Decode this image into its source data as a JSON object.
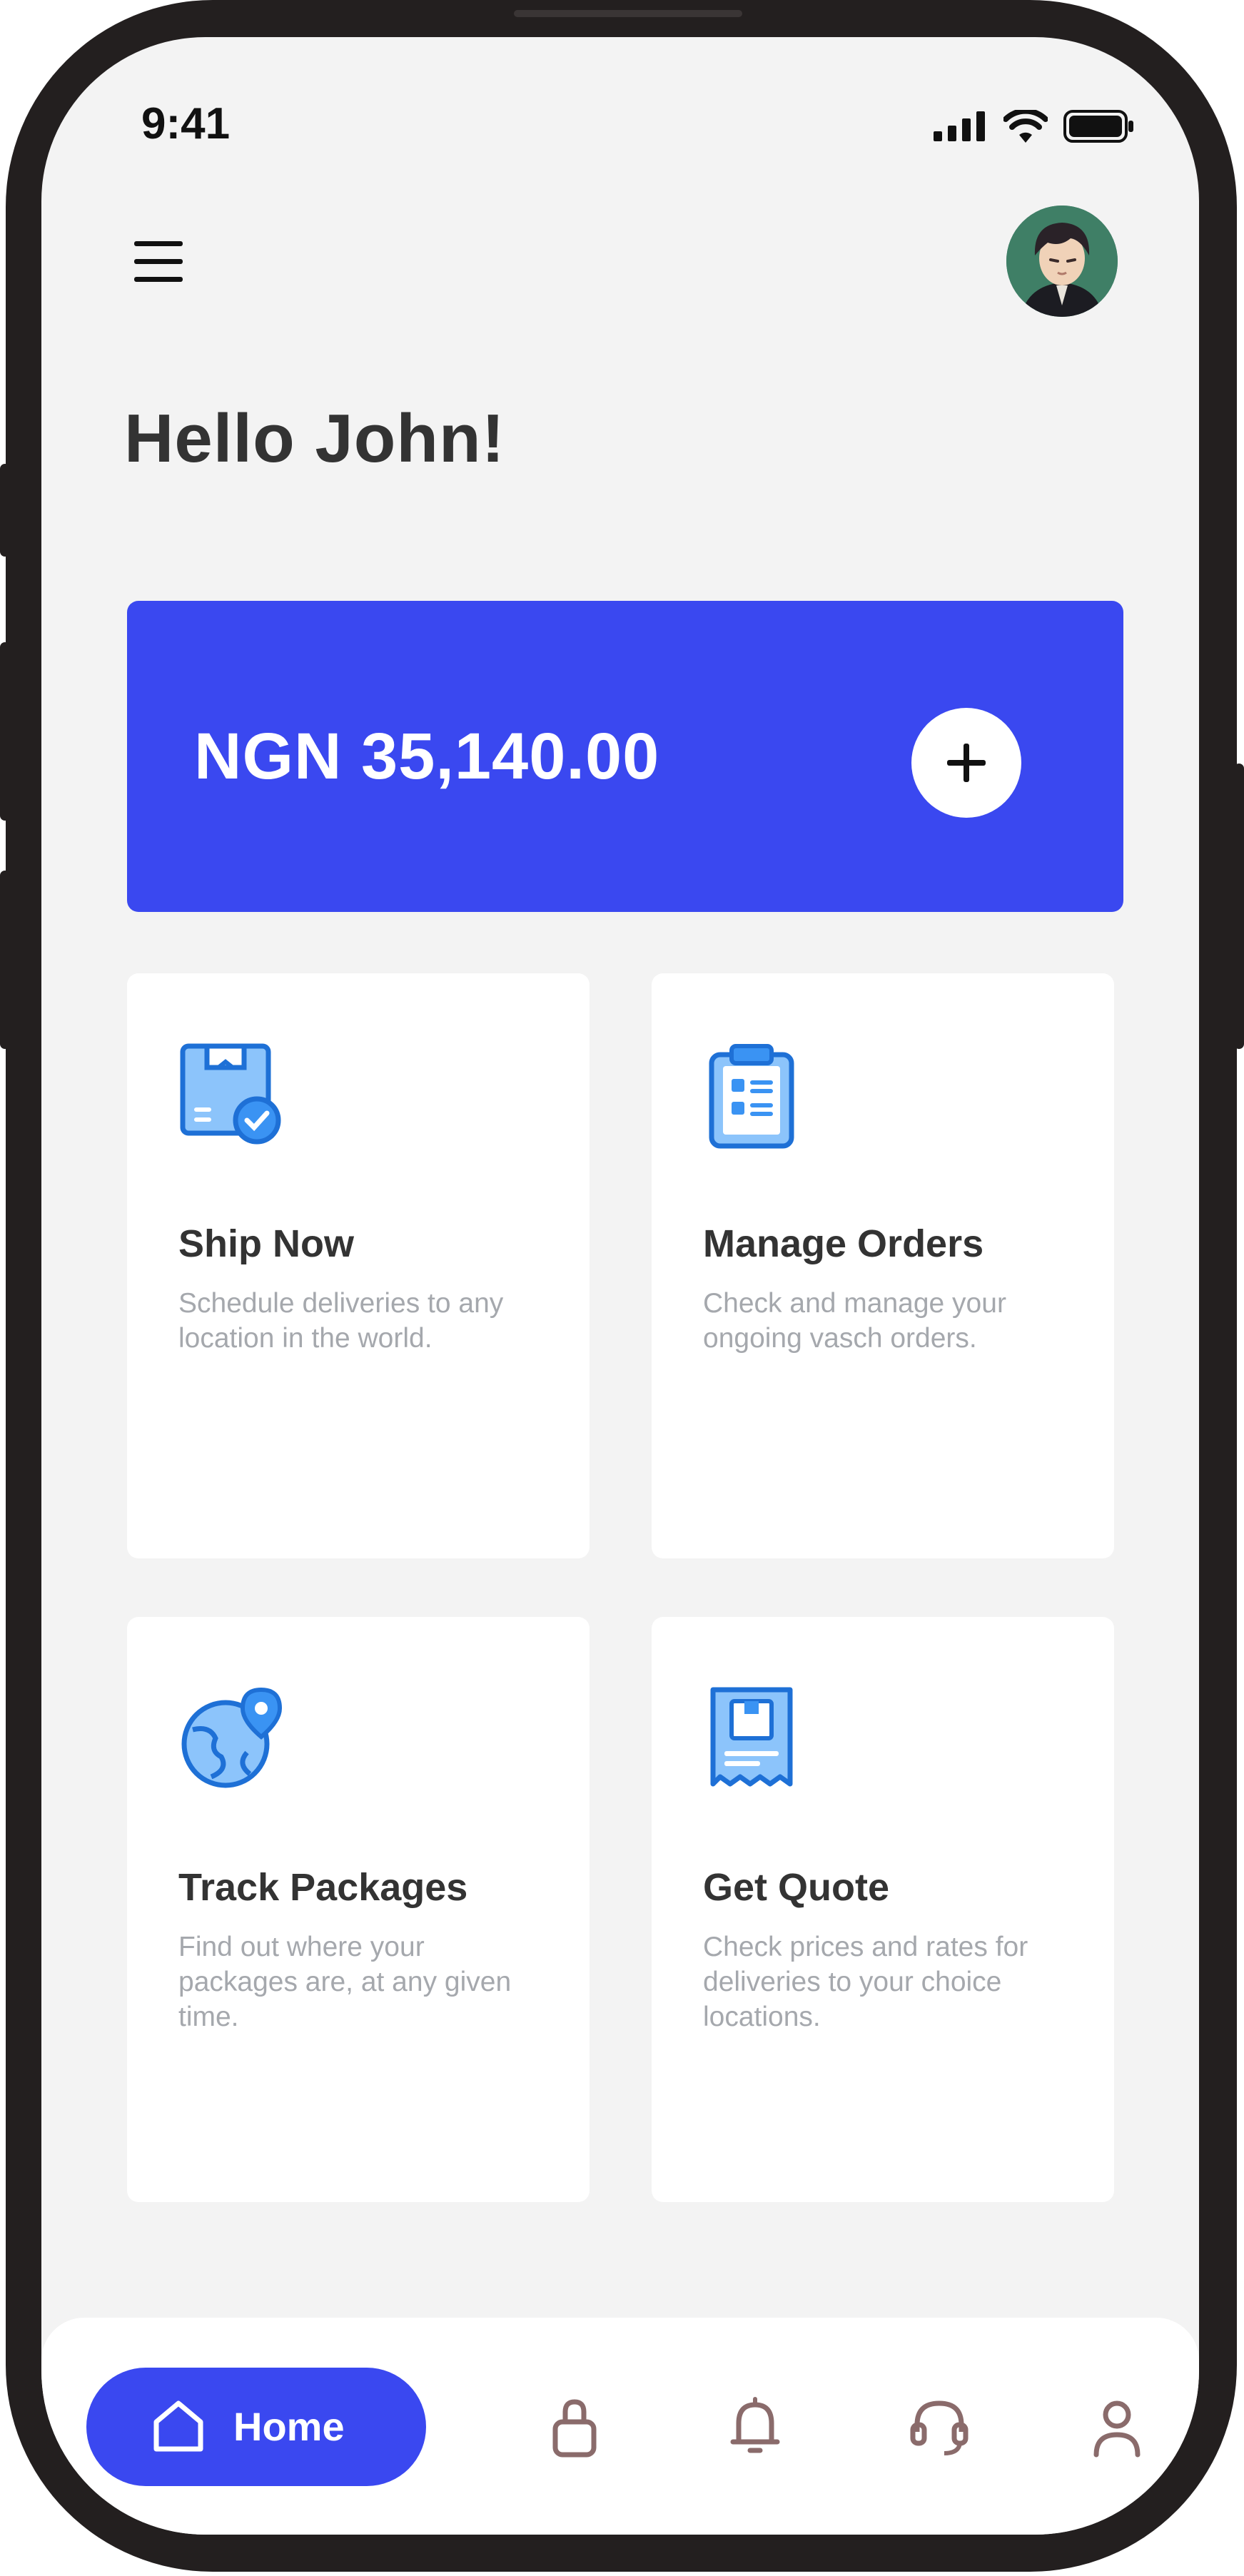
{
  "status_bar": {
    "time": "9:41"
  },
  "header": {
    "greeting": "Hello John!"
  },
  "wallet": {
    "balance": "NGN 35,140.00"
  },
  "tiles": [
    {
      "title": "Ship Now",
      "description": "Schedule deliveries to any location in the world.",
      "icon": "package-check-icon"
    },
    {
      "title": "Manage Orders",
      "description": "Check  and manage your ongoing vasch orders.",
      "icon": "clipboard-list-icon"
    },
    {
      "title": "Track Packages",
      "description": "Find out where your packages are, at any given time.",
      "icon": "globe-pin-icon"
    },
    {
      "title": "Get Quote",
      "description": "Check prices and rates for deliveries to your choice locations.",
      "icon": "receipt-icon"
    }
  ],
  "bottom_nav": {
    "home_label": "Home",
    "items": [
      "shopping-bag-icon",
      "bell-icon",
      "headset-icon",
      "user-icon"
    ]
  },
  "colors": {
    "accent": "#3a48f0",
    "background": "#f3f3f3",
    "tile_icon": "#2d8cf0",
    "frame": "#231f1f"
  }
}
